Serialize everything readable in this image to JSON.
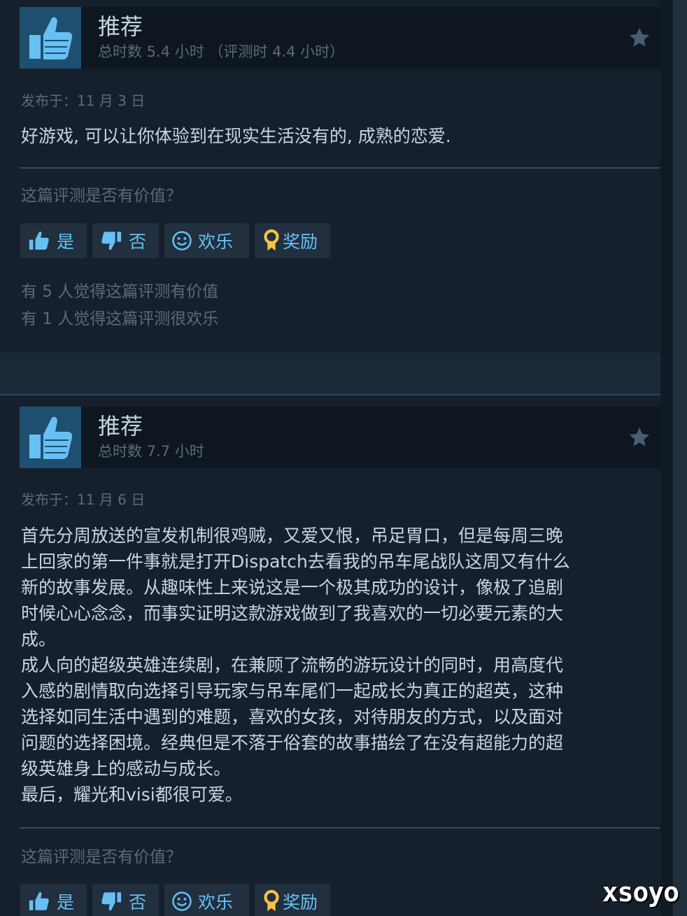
{
  "reviews": [
    {
      "verdict": "推荐",
      "hours": "总时数 5.4 小时 （评测时 4.4 小时）",
      "posted": "发布于：11 月 3 日",
      "body": "好游戏, 可以让你体验到在现实生活没有的, 成熟的恋爱.",
      "question": "这篇评测是否有价值？",
      "buttons": {
        "yes": "是",
        "no": "否",
        "funny": "欢乐",
        "award": "奖励"
      },
      "helpful_count": "有 5 人觉得这篇评测有价值",
      "funny_count": "有 1 人觉得这篇评测很欢乐"
    },
    {
      "verdict": "推荐",
      "hours": "总时数 7.7 小时",
      "posted": "发布于：11 月 6 日",
      "body": "首先分周放送的宣发机制很鸡贼，又爱又恨，吊足胃口，但是每周三晚\n上回家的第一件事就是打开Dispatch去看我的吊车尾战队这周又有什么\n新的故事发展。从趣味性上来说这是一个极其成功的设计，像极了追剧\n时候心心念念，而事实证明这款游戏做到了我喜欢的一切必要元素的大\n成。\n成人向的超级英雄连续剧，在兼顾了流畅的游玩设计的同时，用高度代\n入感的剧情取向选择引导玩家与吊车尾们一起成长为真正的超英，这种\n选择如同生活中遇到的难题，喜欢的女孩，对待朋友的方式，以及面对\n问题的选择困境。经典但是不落于俗套的故事描绘了在没有超能力的超\n级英雄身上的感动与成长。\n最后，耀光和visi都很可爱。",
      "question": "这篇评测是否有价值？",
      "buttons": {
        "yes": "是",
        "no": "否",
        "funny": "欢乐",
        "award": "奖励"
      }
    }
  ],
  "watermark": "xsoyo",
  "icons": {
    "thumb": "thumbs-up-icon",
    "star": "star-icon",
    "vote_yes": "thumbs-up-small-icon",
    "vote_no": "thumbs-down-small-icon",
    "funny": "smiley-icon",
    "award": "award-ribbon-icon"
  },
  "colors": {
    "background": "#1b2838",
    "card": "#16202d",
    "accent": "#66c0f4",
    "text": "#c7d5e0",
    "muted": "#5a6a7a",
    "award": "#f5c242"
  }
}
